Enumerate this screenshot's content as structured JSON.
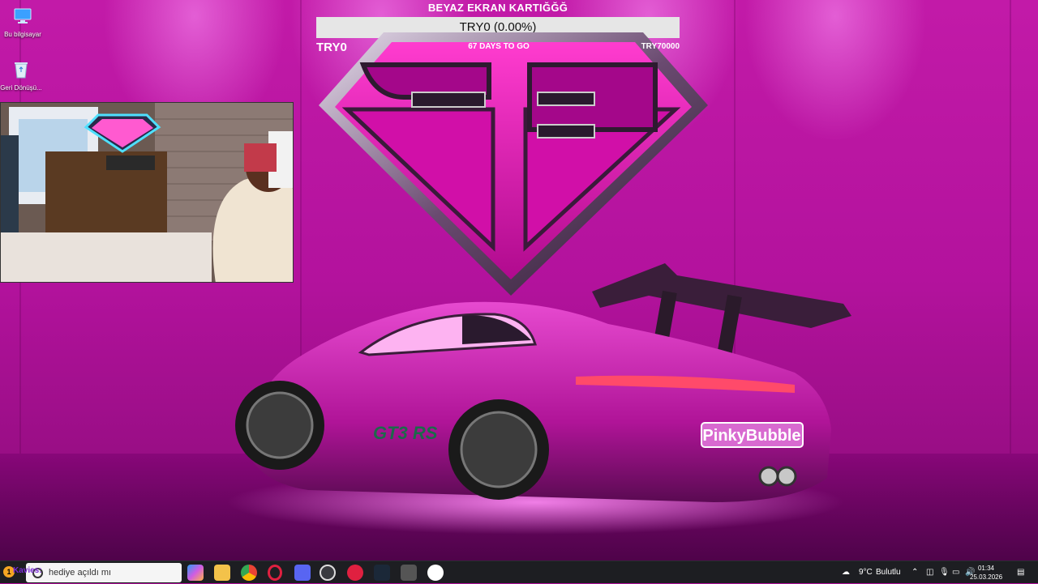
{
  "desktop": {
    "icons": [
      {
        "label": "Bu bilgisayar",
        "icon": "computer-icon"
      },
      {
        "label": "Geri Dönüşü...",
        "icon": "recycle-bin-icon"
      }
    ]
  },
  "donation_goal": {
    "title": "BEYAZ EKRAN KARTIĞĞĞ",
    "progress_text": "TRY0 (0.00%)",
    "progress_percent": 0,
    "min_label": "TRY0",
    "days_left": "67 DAYS TO GO",
    "max_label": "TRY70000"
  },
  "car_plate": "PinkyBubble",
  "car_badge": "GT3 RS",
  "taskbar": {
    "notification_count": "1",
    "overlay_name": "Kavies:",
    "search_text": "hediye açıldı mı",
    "apps": [
      "copilot-icon",
      "file-explorer-icon",
      "chrome-icon",
      "opera-gx-icon",
      "discord-icon",
      "obs-icon",
      "media-player-icon",
      "steam-icon",
      "app-icon",
      "panda-icon"
    ],
    "weather_temp": "9°C",
    "weather_text": "Bulutlu",
    "time": "01:34",
    "date": "25.03.2026"
  },
  "colors": {
    "wall": "#b0109a",
    "taskbar": "#1d1e22",
    "goal_bar": "#e6e6e6"
  }
}
